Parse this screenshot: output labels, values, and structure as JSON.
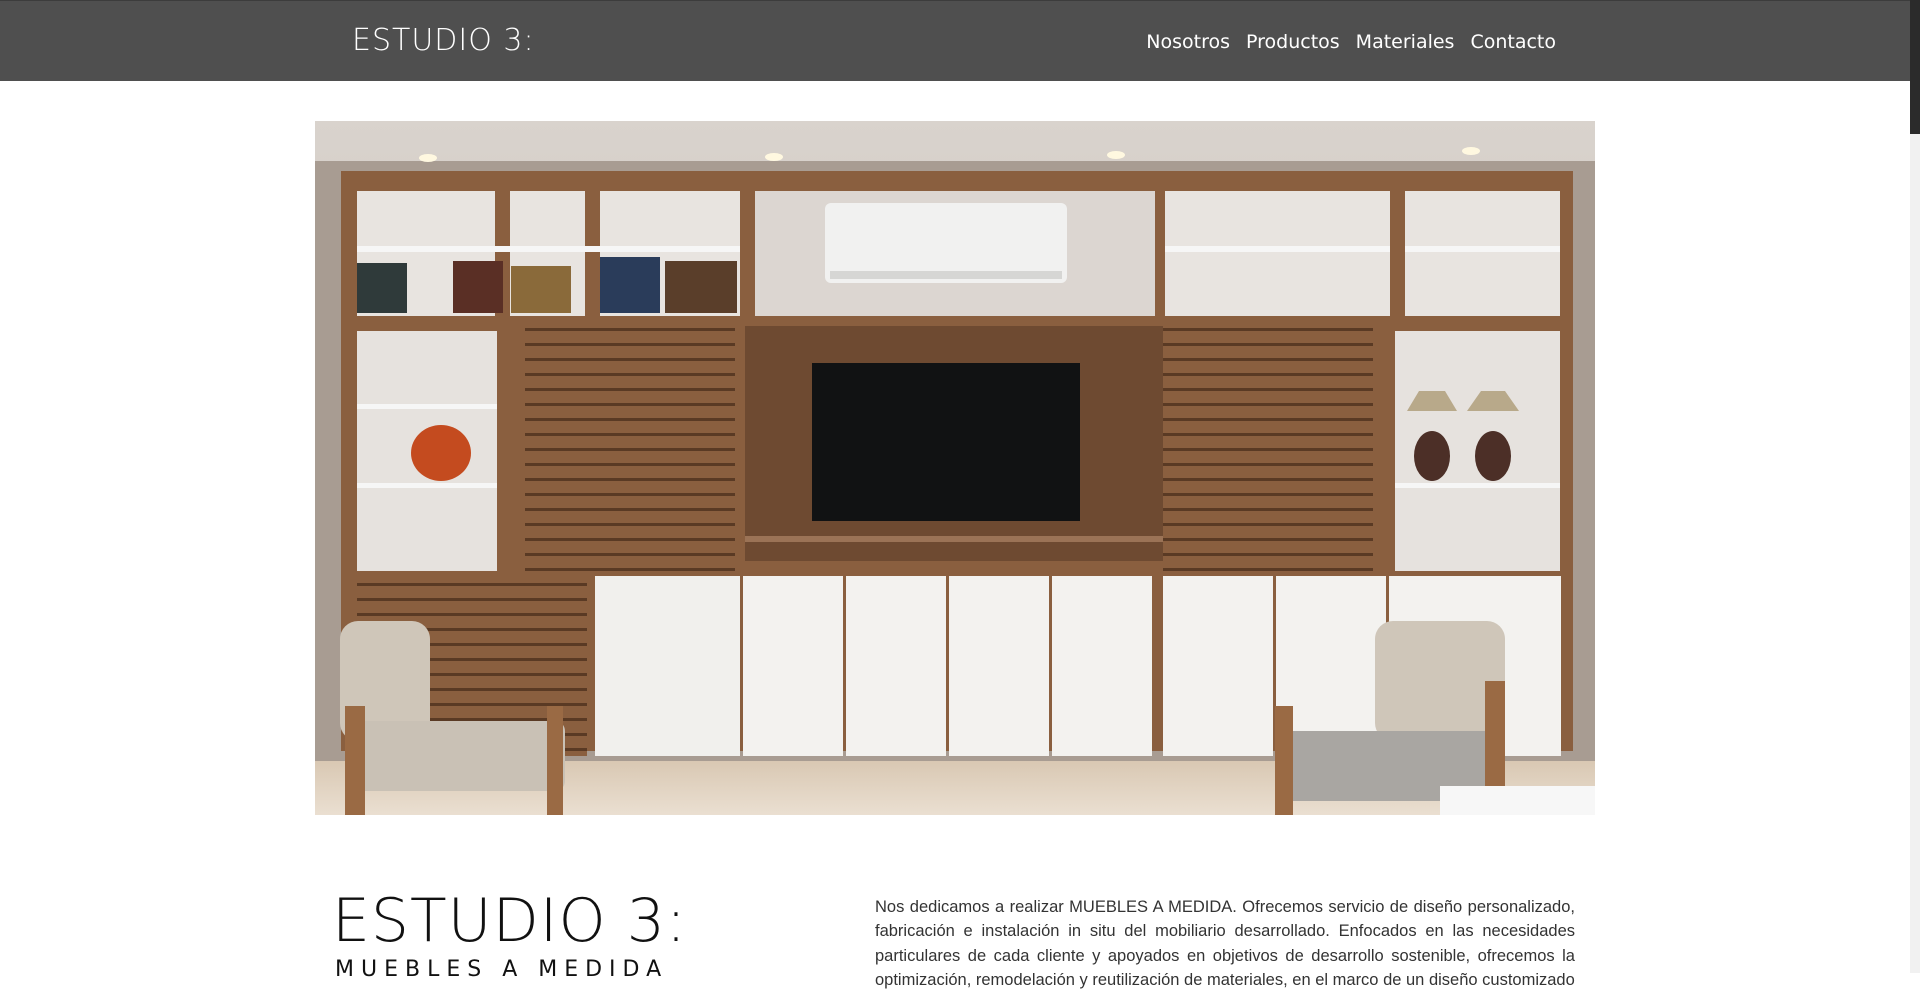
{
  "header": {
    "logo": "ESTUDIO 3:",
    "nav": [
      "Nosotros",
      "Productos",
      "Materiales",
      "Contacto"
    ]
  },
  "intro": {
    "logo": "ESTUDIO 3:",
    "subtitle": "MUEBLES A MEDIDA",
    "text": "Nos dedicamos a realizar MUEBLES A MEDIDA. Ofrecemos servicio de diseño personalizado, fabricación e instalación in situ del mobiliario desarrollado. Enfocados en las necesidades particulares de cada cliente y apoyados en objetivos de desarrollo sostenible, ofrecemos la optimización, remodelación y reutilización de materiales, en el marco de un diseño customizado"
  },
  "colors": {
    "header_bg": "#4f4f4f",
    "wood": "#8a5f3f",
    "white_panel": "#f3f2ef"
  }
}
